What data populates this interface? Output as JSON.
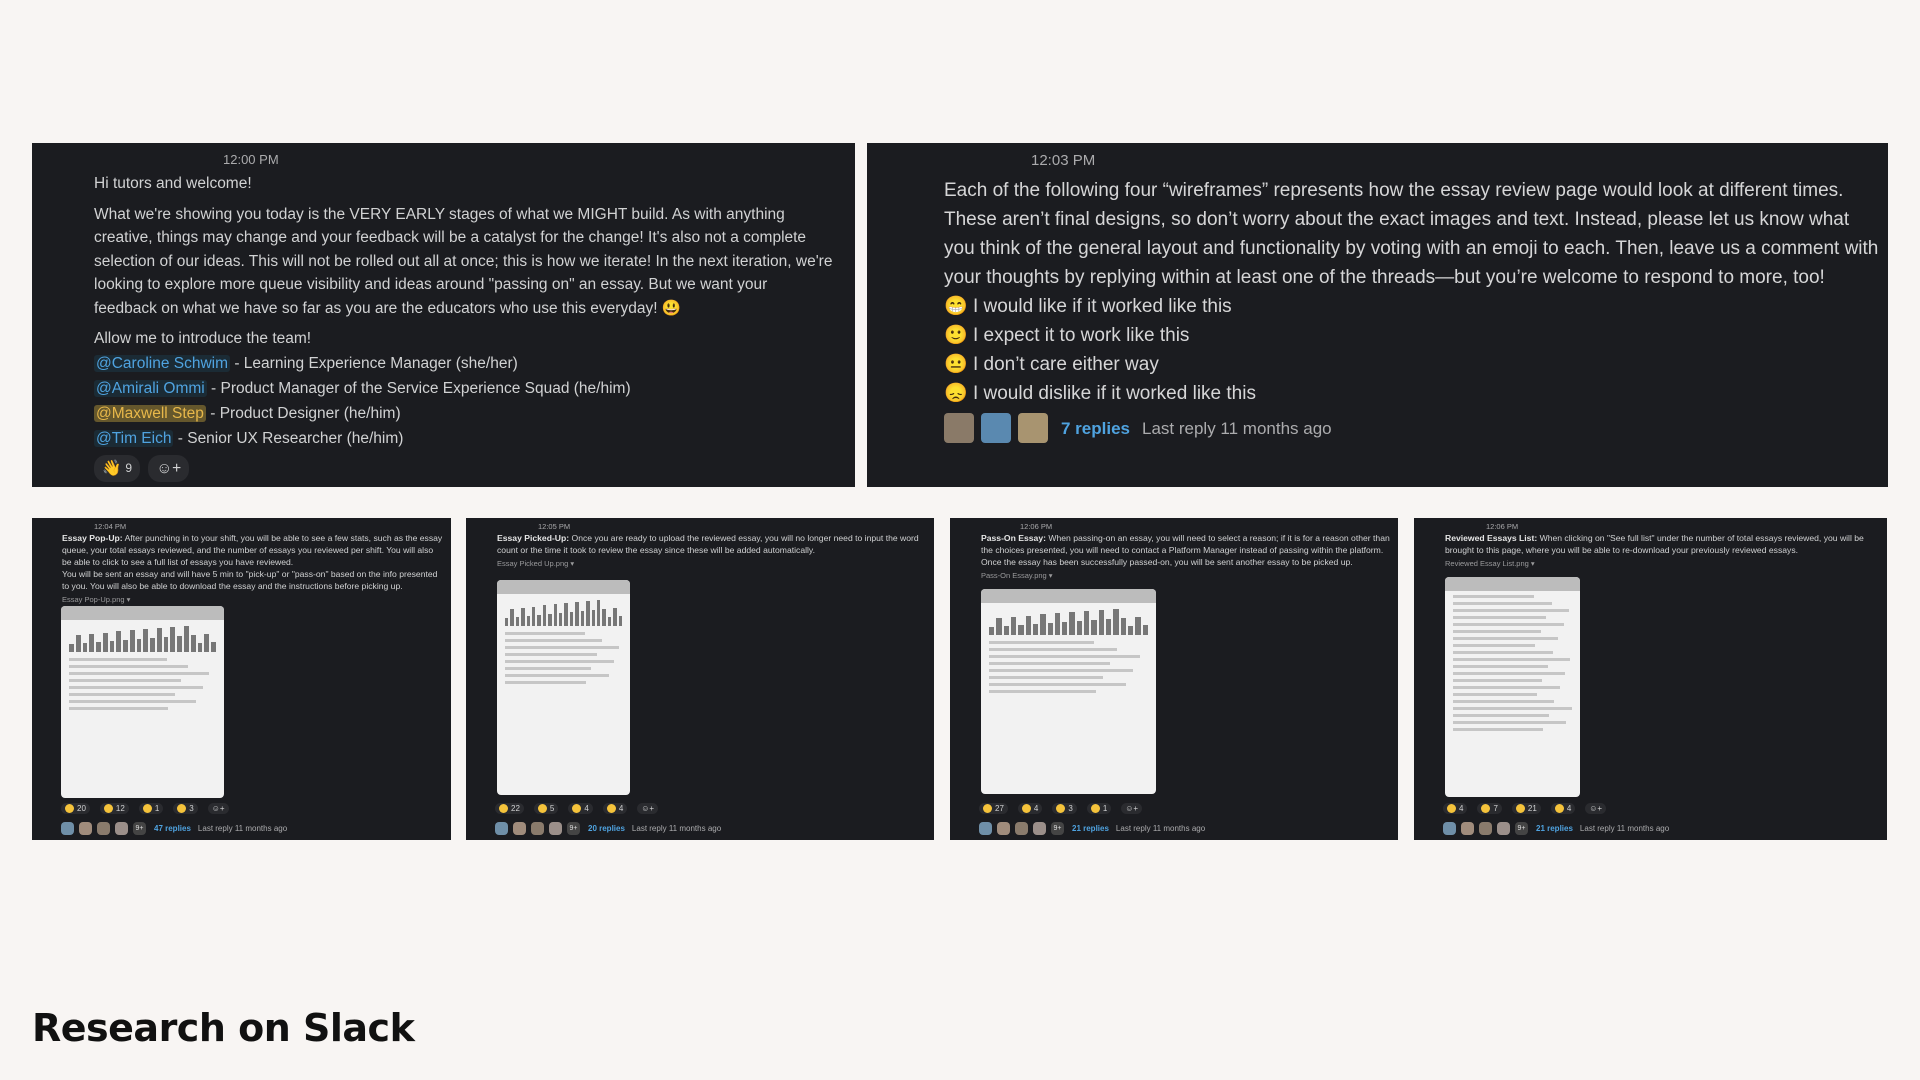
{
  "msg1": {
    "time": "12:00 PM",
    "greeting": "Hi tutors and welcome!",
    "body": "What we're showing you today is the VERY EARLY stages of what we MIGHT build. As with anything creative, things may change and your feedback will be a catalyst for the change! It's also not a complete selection of our ideas. This will not be rolled out all at once; this is how we iterate! In the next iteration, we're looking to explore more queue visibility and ideas around \"passing on\" an essay.  But we want your feedback on what we have so far as you are the educators who use this everyday! 😃",
    "intro": "Allow me to introduce the team!",
    "team": [
      {
        "mention": "@Caroline Schwim",
        "role": " - Learning Experience Manager (she/her)"
      },
      {
        "mention": "@Amirali Ommi",
        "role": " - Product Manager of the Service Experience Squad (he/him)"
      },
      {
        "mention": "@Maxwell Step",
        "role": " - Product Designer (he/him)"
      },
      {
        "mention": "@Tim Eich",
        "role": " - Senior UX Researcher (he/him)"
      }
    ],
    "reaction": {
      "emoji": "👋",
      "count": "9"
    }
  },
  "msg2": {
    "time": "12:03 PM",
    "body": "Each of the following four “wireframes” represents how the essay review page would look at different times. These aren’t final designs, so don’t worry about the exact images and text. Instead, please let us know what you think of the general layout and functionality by voting with an emoji to each. Then, leave us a comment with your thoughts by replying within at least one of the threads—but you’re welcome to respond to more, too!",
    "options": [
      {
        "emoji": "😁",
        "text": "I would like if it worked like this"
      },
      {
        "emoji": "🙂",
        "text": "I expect it to work like this"
      },
      {
        "emoji": "😐",
        "text": "I don’t care either way"
      },
      {
        "emoji": "😞",
        "text": "I would dislike if it worked like this"
      }
    ],
    "replies": "7 replies",
    "last": "Last reply 11 months ago"
  },
  "threads": [
    {
      "time": "12:04 PM",
      "title": "Essay Pop-Up:",
      "text": " After punching in to your shift, you will be able to see a few stats, such as the essay queue, your total essays reviewed, and the number of essays you reviewed per shift. You will also be able to click to see a full list of essays you have reviewed.",
      "text2": "You will be sent an essay and will have 5 min to \"pick-up\" or \"pass-on\" based on the info presented to you. You will also be able to download the essay and the instructions before picking up.",
      "file": "Essay Pop-Up.png ▾",
      "counts": [
        "20",
        "12",
        "1",
        "3"
      ],
      "more": "9+",
      "replies": "47 replies",
      "last": "Last reply 11 months ago"
    },
    {
      "time": "12:05 PM",
      "title": "Essay Picked-Up:",
      "text": " Once you are ready to upload the reviewed essay, you will no longer need to input the word count or the time it took to review the essay since these will be added automatically.",
      "text2": "",
      "file": "Essay Picked Up.png ▾",
      "counts": [
        "22",
        "5",
        "4",
        "4"
      ],
      "more": "9+",
      "replies": "20 replies",
      "last": "Last reply 11 months ago"
    },
    {
      "time": "12:06 PM",
      "title": "Pass-On Essay:",
      "text": " When passing-on an essay, you will need to select a reason; if it is for a reason other than the choices presented, you will need to contact a Platform Manager instead of passing within the platform. Once the essay has been successfully passed-on, you will be sent another essay to be picked up.",
      "text2": "",
      "file": "Pass-On Essay.png ▾",
      "counts": [
        "27",
        "4",
        "3",
        "1"
      ],
      "more": "9+",
      "replies": "21 replies",
      "last": "Last reply 11 months ago"
    },
    {
      "time": "12:06 PM",
      "title": "Reviewed Essays List:",
      "text": " When clicking on \"See full list\" under the number of total essays reviewed, you will be brought to this page, where you will be able to re-download your previously reviewed essays.",
      "text2": "",
      "file": "Reviewed Essay List.png ▾",
      "counts": [
        "4",
        "7",
        "21",
        "4"
      ],
      "more": "9+",
      "replies": "21 replies",
      "last": "Last reply 11 months ago"
    }
  ],
  "emojis": [
    "😁",
    "🙂",
    "😐",
    "😞"
  ],
  "page_title": "Research on Slack",
  "colors": {
    "panel": "#1b1c20",
    "link": "#4fa3e0",
    "highlight": "#e8b84a",
    "background": "#f8f5f3"
  }
}
